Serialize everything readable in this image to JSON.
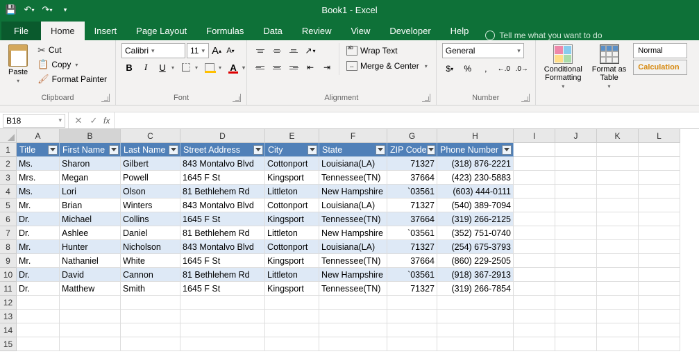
{
  "app": {
    "docTitle": "Book1 - Excel"
  },
  "tabs": {
    "file": "File",
    "home": "Home",
    "insert": "Insert",
    "pageLayout": "Page Layout",
    "formulas": "Formulas",
    "data": "Data",
    "review": "Review",
    "view": "View",
    "developer": "Developer",
    "help": "Help",
    "tellMe": "Tell me what you want to do"
  },
  "clipboard": {
    "paste": "Paste",
    "cut": "Cut",
    "copy": "Copy",
    "formatPainter": "Format Painter",
    "label": "Clipboard"
  },
  "font": {
    "name": "Calibri",
    "size": "11",
    "bold": "B",
    "italic": "I",
    "underline": "U",
    "label": "Font",
    "biggerA": "A",
    "smallerA": "A",
    "colorA": "A"
  },
  "alignment": {
    "wrap": "Wrap Text",
    "merge": "Merge & Center",
    "label": "Alignment"
  },
  "number": {
    "format": "General",
    "label": "Number",
    "currency": "$",
    "percent": "%",
    "comma": ",",
    "inc": ".0",
    "dec": ".00"
  },
  "styles": {
    "cf": "Conditional\nFormatting",
    "fat": "Format as\nTable",
    "normal": "Normal",
    "calculation": "Calculation"
  },
  "nameBox": "B18",
  "fx": "fx",
  "columns": [
    "A",
    "B",
    "C",
    "D",
    "E",
    "F",
    "G",
    "H",
    "I",
    "J",
    "K",
    "L"
  ],
  "colWidths": {
    "A": 62,
    "B": 88,
    "C": 86,
    "D": 122,
    "E": 78,
    "F": 98,
    "G": 72,
    "H": 110,
    "I": 60,
    "J": 60,
    "K": 60,
    "L": 60
  },
  "rowNums": [
    "1",
    "2",
    "3",
    "4",
    "5",
    "6",
    "7",
    "8",
    "9",
    "10",
    "11",
    "12",
    "13",
    "14",
    "15"
  ],
  "headers": [
    "Title",
    "First Name",
    "Last Name",
    "Street Address",
    "City",
    "State",
    "ZIP Code",
    "Phone Number"
  ],
  "rows": [
    [
      "Ms.",
      "Sharon",
      "Gilbert",
      "843 Montalvo Blvd",
      "Cottonport",
      "Louisiana(LA)",
      "71327",
      "(318) 876-2221"
    ],
    [
      "Mrs.",
      "Megan",
      "Powell",
      "1645 F St",
      "Kingsport",
      "Tennessee(TN)",
      "37664",
      "(423) 230-5883"
    ],
    [
      "Ms.",
      "Lori",
      "Olson",
      "81 Bethlehem Rd",
      "Littleton",
      "New Hampshire",
      "`03561",
      "(603) 444-0111"
    ],
    [
      "Mr.",
      "Brian",
      "Winters",
      "843 Montalvo Blvd",
      "Cottonport",
      "Louisiana(LA)",
      "71327",
      "(540) 389-7094"
    ],
    [
      "Dr.",
      "Michael",
      "Collins",
      "1645 F St",
      "Kingsport",
      "Tennessee(TN)",
      "37664",
      "(319) 266-2125"
    ],
    [
      "Dr.",
      "Ashlee",
      "Daniel",
      "81 Bethlehem Rd",
      "Littleton",
      "New Hampshire",
      "`03561",
      "(352) 751-0740"
    ],
    [
      "Mr.",
      "Hunter",
      "Nicholson",
      "843 Montalvo Blvd",
      "Cottonport",
      "Louisiana(LA)",
      "71327",
      "(254) 675-3793"
    ],
    [
      "Mr.",
      "Nathaniel",
      "White",
      "1645 F St",
      "Kingsport",
      "Tennessee(TN)",
      "37664",
      "(860) 229-2505"
    ],
    [
      "Dr.",
      "David",
      "Cannon",
      "81 Bethlehem Rd",
      "Littleton",
      "New Hampshire",
      "`03561",
      "(918) 367-2913"
    ],
    [
      "Dr.",
      "Matthew",
      "Smith",
      "1645 F St",
      "Kingsport",
      "Tennessee(TN)",
      "71327",
      "(319) 266-7854"
    ]
  ]
}
